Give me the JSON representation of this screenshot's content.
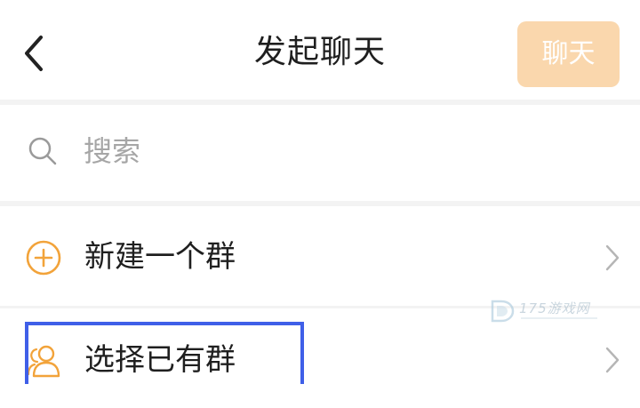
{
  "header": {
    "back_icon": "chevron-left-icon",
    "title": "发起聊天",
    "chat_button": "聊天"
  },
  "search": {
    "icon": "search-icon",
    "placeholder": "搜索"
  },
  "rows": [
    {
      "icon": "plus-circle-icon",
      "label": "新建一个群",
      "trailing": "chevron-right-icon"
    },
    {
      "icon": "group-icon",
      "label": "选择已有群",
      "trailing": "chevron-right-icon"
    }
  ],
  "colors": {
    "accent": "#f2a33a",
    "chat_button_disabled": "#fad7ad",
    "highlight_box": "#3f5fe8"
  },
  "watermark": {
    "text": "175游戏网"
  }
}
